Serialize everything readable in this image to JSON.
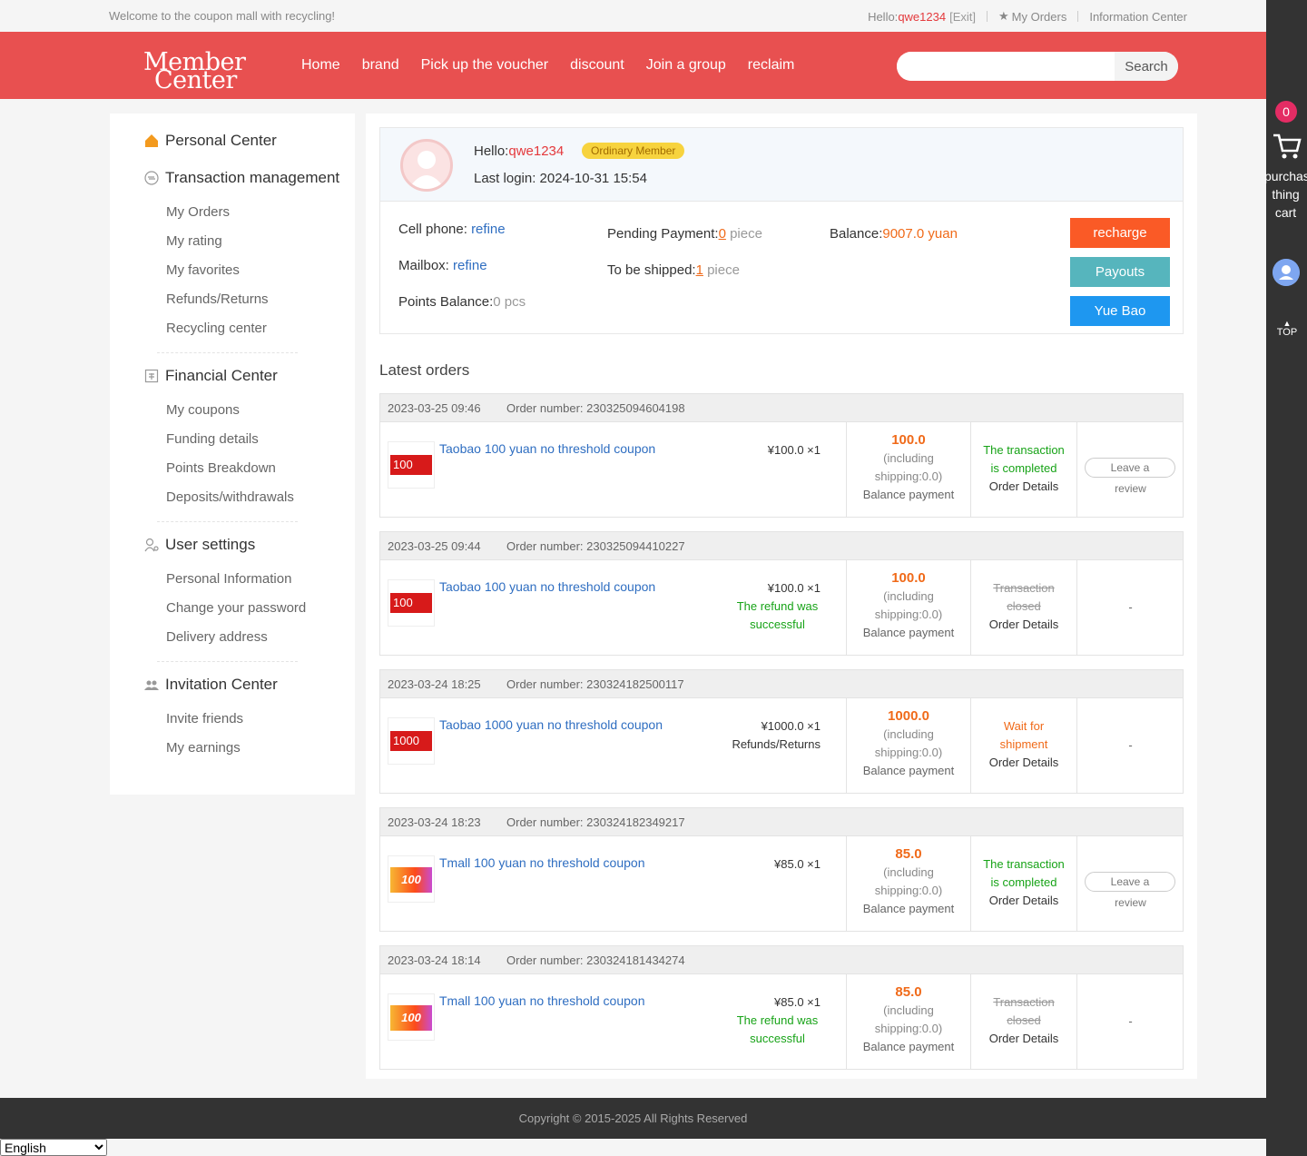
{
  "topbar": {
    "welcome": "Welcome to the coupon mall with recycling!",
    "hello_label": "Hello:",
    "username": "qwe1234",
    "exit": "[Exit]",
    "my_orders": "My Orders",
    "info_center": "Information Center"
  },
  "header": {
    "logo_line1": "Member",
    "logo_line2": "Center",
    "nav": [
      "Home",
      "brand",
      "Pick up the voucher",
      "discount",
      "Join a group",
      "reclaim"
    ],
    "search_placeholder": "",
    "search_button": "Search"
  },
  "right_sidebar": {
    "cart_count": "0",
    "cart_label": "purchasing thing cart",
    "top_label": "TOP"
  },
  "menu": {
    "personal_center": "Personal Center",
    "transaction_management": "Transaction management",
    "transaction_items": [
      "My Orders",
      "My rating",
      "My favorites",
      "Refunds/Returns",
      "Recycling center"
    ],
    "financial_center": "Financial Center",
    "financial_items": [
      "My coupons",
      "Funding details",
      "Points Breakdown",
      "Deposits/withdrawals"
    ],
    "user_settings": "User settings",
    "settings_items": [
      "Personal Information",
      "Change your password",
      "Delivery address"
    ],
    "invitation_center": "Invitation Center",
    "invitation_items": [
      "Invite friends",
      "My earnings"
    ]
  },
  "profile": {
    "hello_label": "Hello:",
    "username": "qwe1234",
    "member_level": "Ordinary Member",
    "last_login": "Last login: 2024-10-31 15:54",
    "cell_phone_label": "Cell phone: ",
    "cell_phone_value": "refine",
    "mailbox_label": "Mailbox: ",
    "mailbox_value": "refine",
    "points_label": "Points Balance:",
    "points_value": "0 pcs",
    "pending_label": "Pending Payment:",
    "pending_count": "0",
    "pending_unit": " piece",
    "shipped_label": "To be shipped:",
    "shipped_count": "1",
    "shipped_unit": " piece",
    "balance_label": "Balance:",
    "balance_value": "9007.0 yuan",
    "btn_recharge": "recharge",
    "btn_payouts": "Payouts",
    "btn_yuebao": "Yue Bao",
    "colors": {
      "recharge": "#fa5a26",
      "payouts": "#56b5bd",
      "yuebao": "#1e97f0"
    }
  },
  "latest_title": "Latest orders",
  "orders": [
    {
      "date": "2023-03-25 09:46",
      "number": "Order number: 230325094604198",
      "thumb_text": "100",
      "thumb_style": "red",
      "name": "Taobao 100 yuan no threshold coupon",
      "price": "¥100.0 ×1",
      "price_note": "",
      "price_note_style": "",
      "amount": "100.0",
      "ship1": "(including",
      "ship2": "shipping:0.0)",
      "pay": "Balance payment",
      "status1": "The transaction",
      "status2": "is completed",
      "status_style": "green",
      "details": "Order Details",
      "action": "review"
    },
    {
      "date": "2023-03-25 09:44",
      "number": "Order number: 230325094410227",
      "thumb_text": "100",
      "thumb_style": "red",
      "name": "Taobao 100 yuan no threshold coupon",
      "price": "¥100.0 ×1",
      "price_note": "The refund was successful",
      "price_note_style": "green",
      "amount": "100.0",
      "ship1": "(including",
      "ship2": "shipping:0.0)",
      "pay": "Balance payment",
      "status1": "Transaction",
      "status2": "closed",
      "status_style": "strike",
      "details": "Order Details",
      "action": "none"
    },
    {
      "date": "2023-03-24 18:25",
      "number": "Order number: 230324182500117",
      "thumb_text": "1000",
      "thumb_style": "red",
      "name": "Taobao 1000 yuan no threshold coupon",
      "price": "¥1000.0 ×1",
      "price_note": "Refunds/Returns",
      "price_note_style": "dark",
      "amount": "1000.0",
      "ship1": "(including",
      "ship2": "shipping:0.0)",
      "pay": "Balance payment",
      "status1": "Wait for",
      "status2": "shipment",
      "status_style": "orange",
      "details": "Order Details",
      "action": "none"
    },
    {
      "date": "2023-03-24 18:23",
      "number": "Order number: 230324182349217",
      "thumb_text": "100",
      "thumb_style": "gold",
      "name": "Tmall 100 yuan no threshold coupon",
      "price": "¥85.0 ×1",
      "price_note": "",
      "price_note_style": "",
      "amount": "85.0",
      "ship1": "(including",
      "ship2": "shipping:0.0)",
      "pay": "Balance payment",
      "status1": "The transaction",
      "status2": "is completed",
      "status_style": "green",
      "details": "Order Details",
      "action": "review"
    },
    {
      "date": "2023-03-24 18:14",
      "number": "Order number: 230324181434274",
      "thumb_text": "100",
      "thumb_style": "gold",
      "name": "Tmall 100 yuan no threshold coupon",
      "price": "¥85.0 ×1",
      "price_note": "The refund was successful",
      "price_note_style": "green",
      "amount": "85.0",
      "ship1": "(including",
      "ship2": "shipping:0.0)",
      "pay": "Balance payment",
      "status1": "Transaction",
      "status2": "closed",
      "status_style": "strike",
      "details": "Order Details",
      "action": "none"
    }
  ],
  "review": {
    "line1": "Leave a",
    "line2": "review",
    "dash": "-"
  },
  "footer": "Copyright © 2015-2025 All Rights Reserved",
  "language": "English"
}
